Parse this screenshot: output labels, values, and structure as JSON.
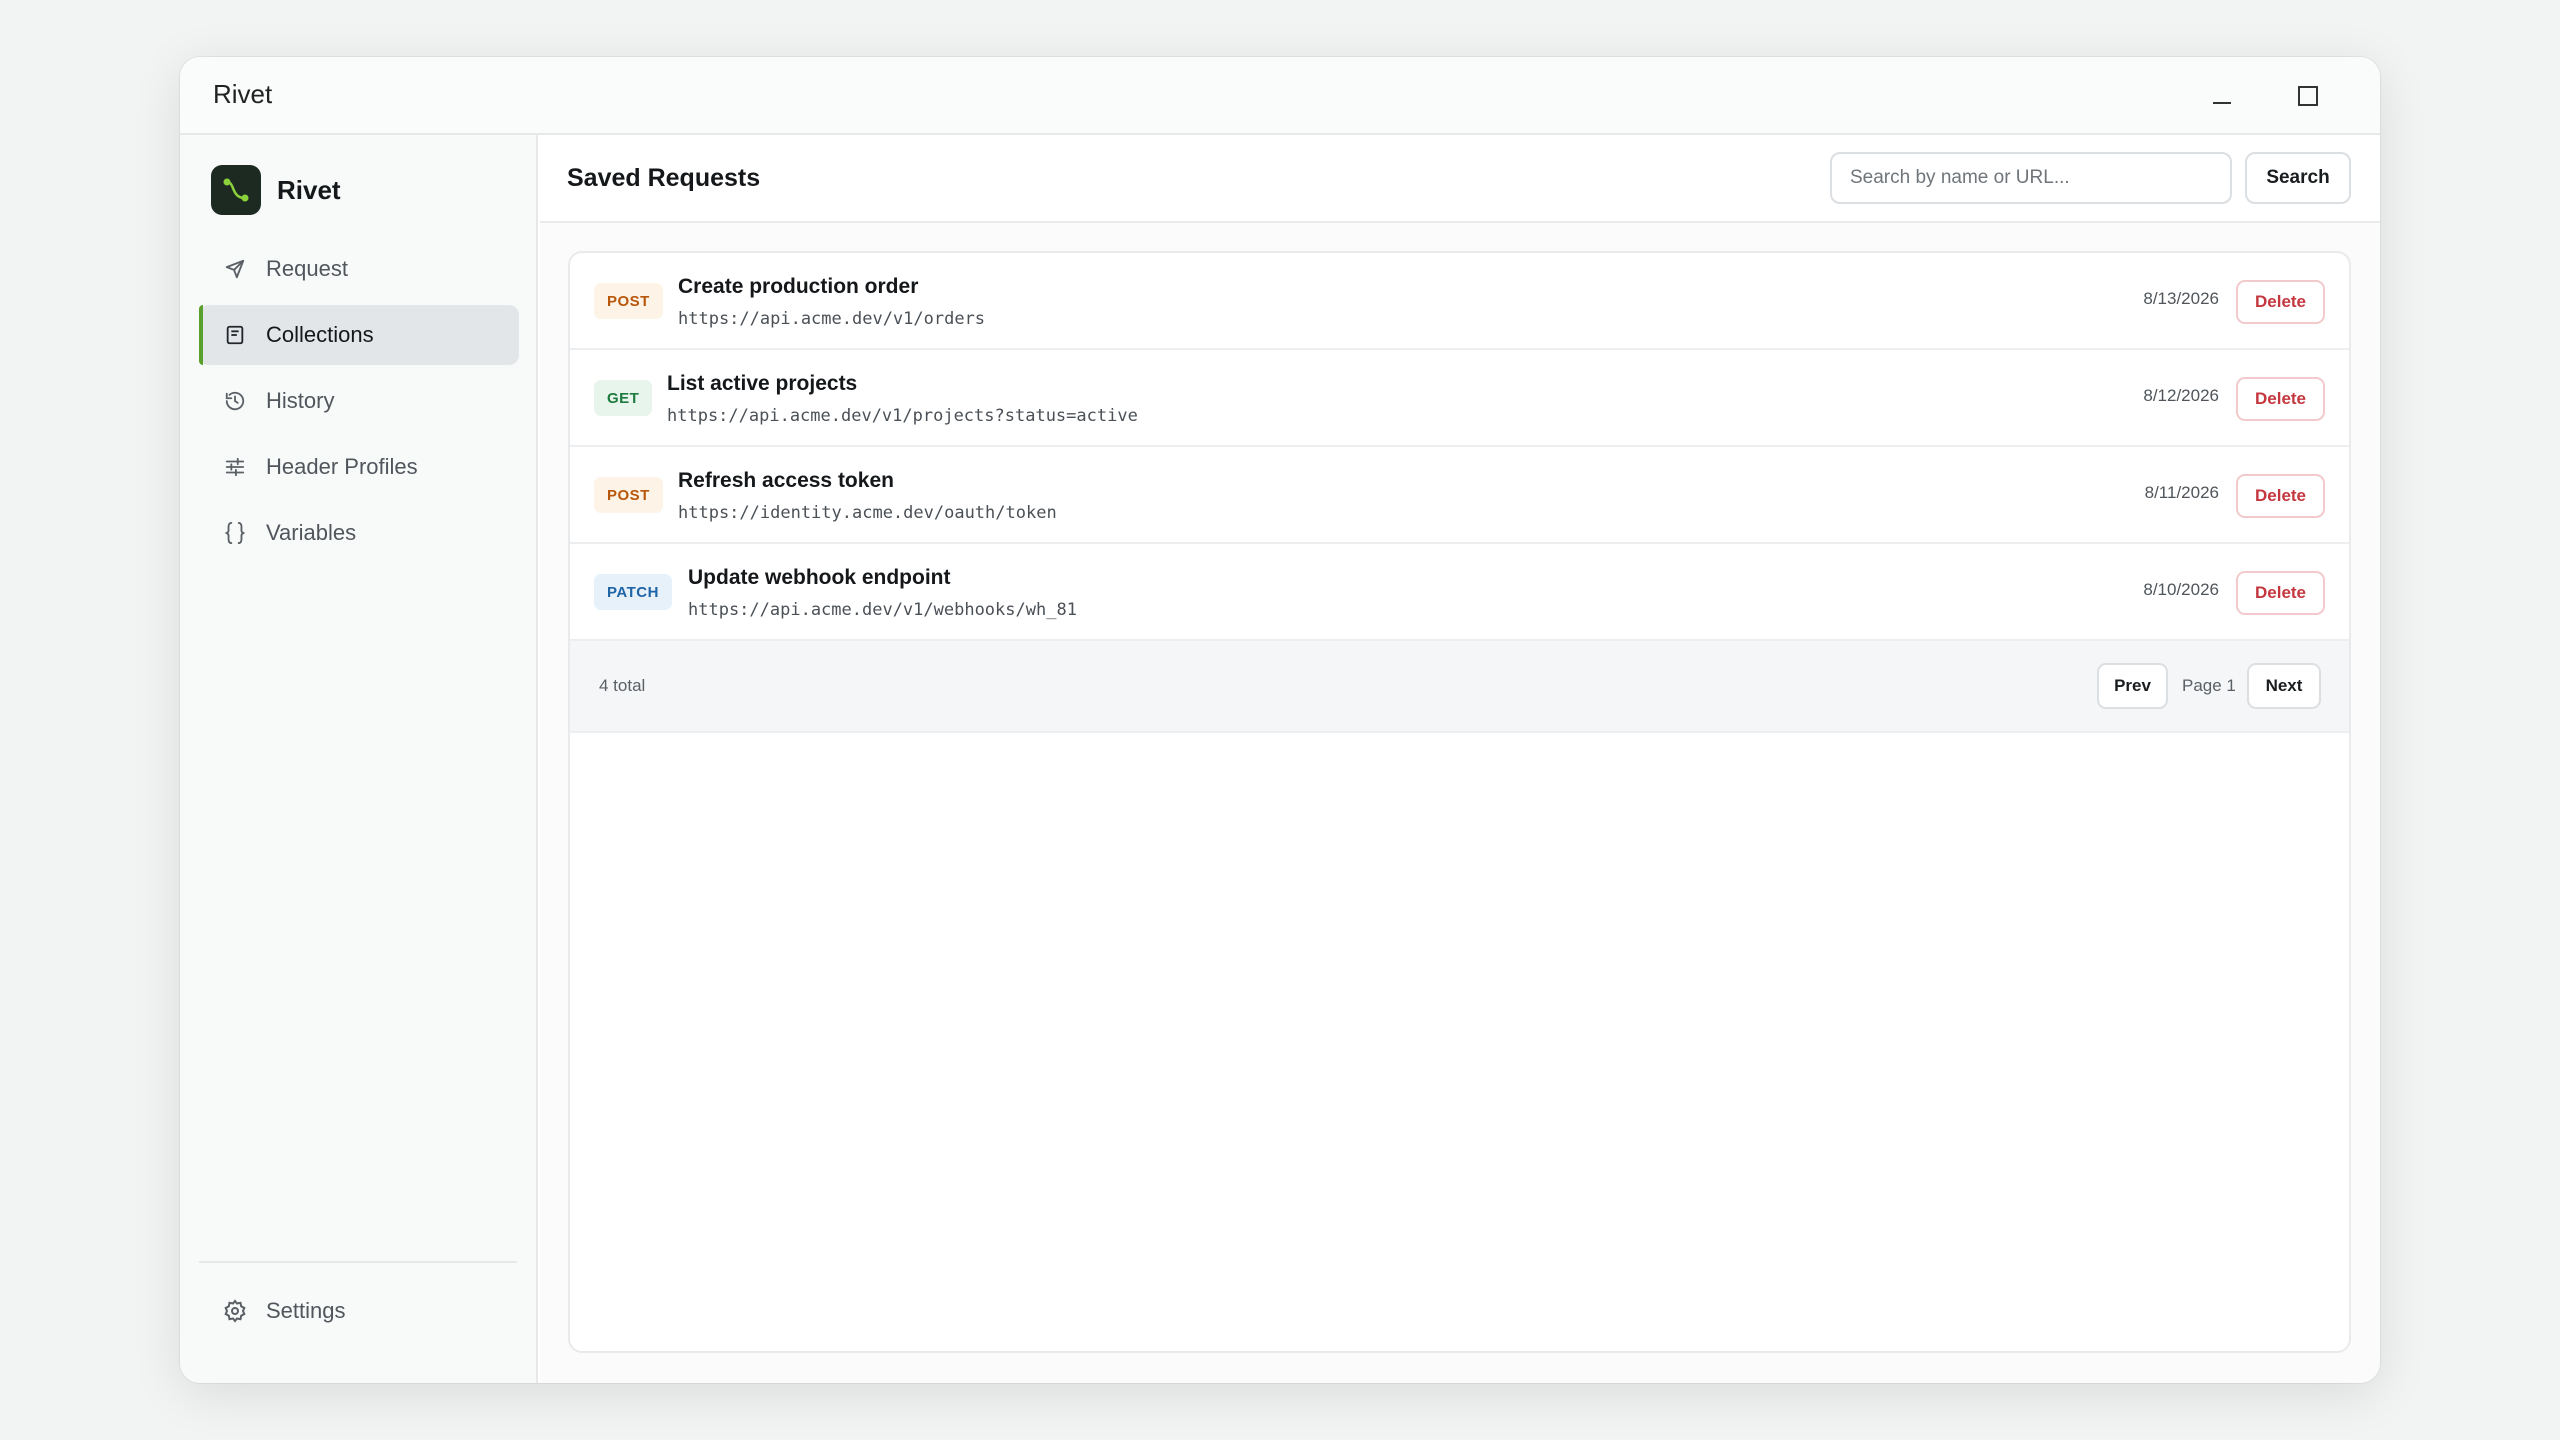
{
  "window": {
    "title": "Rivet"
  },
  "sidebar": {
    "brand": "Rivet",
    "items": [
      {
        "label": "Request",
        "icon": "send-icon",
        "active": false
      },
      {
        "label": "Collections",
        "icon": "document-icon",
        "active": true
      },
      {
        "label": "History",
        "icon": "history-icon",
        "active": false
      },
      {
        "label": "Header Profiles",
        "icon": "sliders-icon",
        "active": false
      },
      {
        "label": "Variables",
        "icon": "braces-icon",
        "active": false
      }
    ],
    "settings_label": "Settings",
    "language": "en"
  },
  "main": {
    "title": "Saved Requests",
    "search": {
      "placeholder": "Search by name or URL...",
      "value": "",
      "button": "Search"
    },
    "requests": [
      {
        "method": "POST",
        "name": "Create production order",
        "url": "https://api.acme.dev/v1/orders",
        "date": "8/13/2026",
        "delete": "Delete"
      },
      {
        "method": "GET",
        "name": "List active projects",
        "url": "https://api.acme.dev/v1/projects?status=active",
        "date": "8/12/2026",
        "delete": "Delete"
      },
      {
        "method": "POST",
        "name": "Refresh access token",
        "url": "https://identity.acme.dev/oauth/token",
        "date": "8/11/2026",
        "delete": "Delete"
      },
      {
        "method": "PATCH",
        "name": "Update webhook endpoint",
        "url": "https://api.acme.dev/v1/webhooks/wh_81",
        "date": "8/10/2026",
        "delete": "Delete"
      }
    ],
    "footer": {
      "total": "4 total",
      "prev": "Prev",
      "page": "Page 1",
      "next": "Next"
    }
  },
  "colors": {
    "accent": "#5aa02c",
    "danger": "#c4373f",
    "post": "#b8560a",
    "get": "#1e7a3e",
    "patch": "#1f64a6"
  }
}
